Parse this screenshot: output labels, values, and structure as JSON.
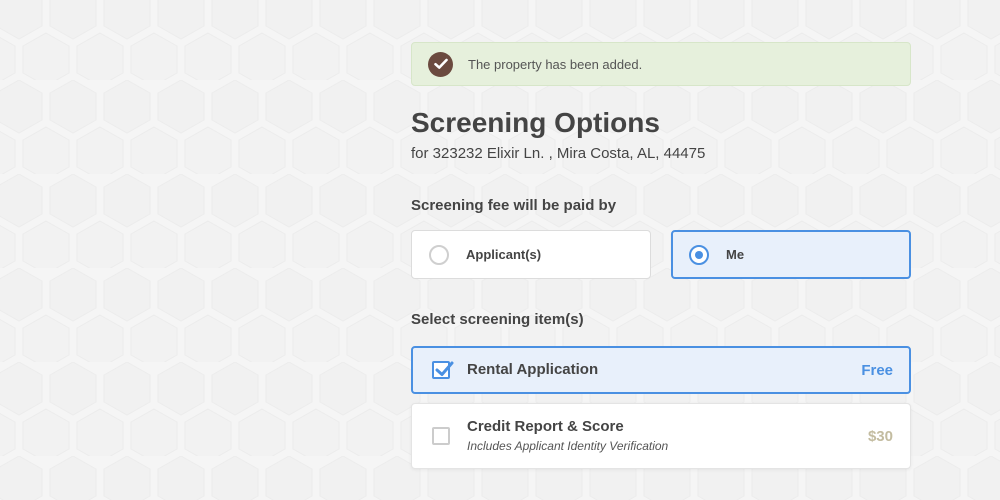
{
  "alert": {
    "message": "The property has been added.",
    "icon": "check-circle-icon",
    "color": "#6b4a3f"
  },
  "header": {
    "title": "Screening Options",
    "subtitle": "for 323232 Elixir Ln. , Mira Costa, AL, 44475"
  },
  "fee": {
    "label": "Screening fee will be paid by",
    "options": [
      {
        "label": "Applicant(s)",
        "selected": false
      },
      {
        "label": "Me",
        "selected": true
      }
    ]
  },
  "items": {
    "label": "Select screening item(s)",
    "list": [
      {
        "name": "Rental Application",
        "note": "",
        "price": "Free",
        "checked": true
      },
      {
        "name": "Credit Report & Score",
        "note": "Includes Applicant Identity Verification",
        "price": "$30",
        "checked": false
      }
    ]
  },
  "colors": {
    "accent": "#4a90e2",
    "selected_bg": "#e8f0fb",
    "alert_bg": "#e6f0dc",
    "price_muted": "#c3bca0"
  }
}
